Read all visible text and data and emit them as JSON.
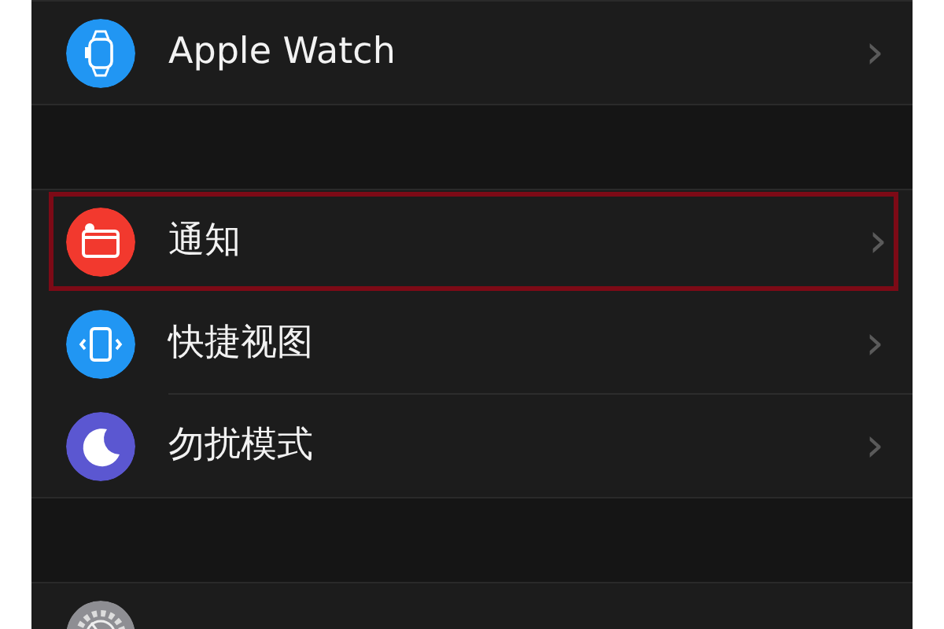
{
  "sections": [
    {
      "items": [
        {
          "label": "Apple Watch",
          "kind": "watch",
          "color": "#2196f3",
          "highlighted": false,
          "chevron": "›"
        }
      ]
    },
    {
      "items": [
        {
          "label": "通知",
          "kind": "notification",
          "color": "#f2392e",
          "highlighted": true,
          "chevron": "›"
        },
        {
          "label": "快捷视图",
          "kind": "glances",
          "color": "#2196f3",
          "highlighted": false,
          "chevron": "›"
        },
        {
          "label": "勿扰模式",
          "kind": "moon",
          "color": "#5b57d1",
          "highlighted": false,
          "chevron": "›"
        }
      ]
    },
    {
      "items": [
        {
          "kind": "gear",
          "color": "#8e8e93",
          "highlighted": false
        }
      ]
    }
  ]
}
